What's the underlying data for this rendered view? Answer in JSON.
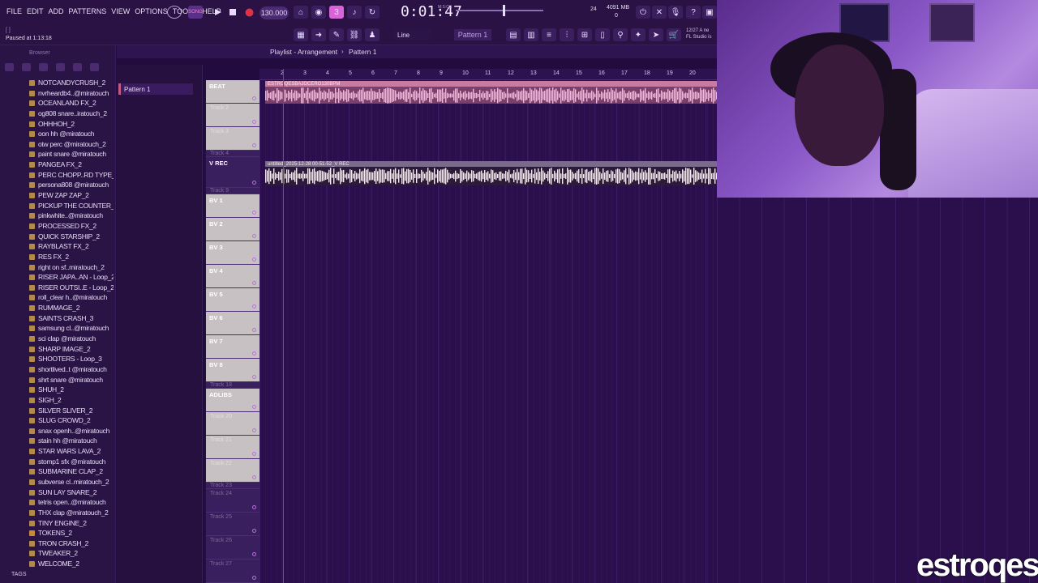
{
  "menu": [
    "FILE",
    "EDIT",
    "ADD",
    "PATTERNS",
    "VIEW",
    "OPTIONS",
    "TOOLS",
    "HELP"
  ],
  "status": {
    "line1": "[ ]",
    "line2": "Paused at 1:13:18"
  },
  "transport": {
    "tempo": "130.000",
    "time": "0:01:47",
    "time_label": "M:S:CS",
    "cpu": "24",
    "memory": "4091 MB",
    "memory_sub": "0",
    "snap": "Line",
    "pattern": "Pattern 1"
  },
  "news": {
    "line1": "12/27  A ne",
    "line2": "FL Studio is"
  },
  "browser": {
    "title": "Browser",
    "files": [
      "NOTCANDYCRUSH_2",
      "nvrheardb4..@miratouch",
      "OCEANLAND FX_2",
      "og808 snare..iratouch_2",
      "OHHHOH_2",
      "oon hh @miratouch",
      "otw perc @miratouch_2",
      "paint snare @miratouch",
      "PANGEA FX_2",
      "PERC CHOPP..RD TYPE_2",
      "persona808 @miratouch",
      "PEW ZAP ZAP_2",
      "PICKUP THE COUNTER_2",
      "pinkwhite..@miratouch",
      "PROCESSED FX_2",
      "QUICK STARSHIP_2",
      "RAYBLAST FX_2",
      "RES FX_2",
      "right on sf..miratouch_2",
      "RISER JAPA..AN - Loop_2",
      "RISER OUTSI..E - Loop_2",
      "roll_clear h..@miratouch",
      "RUMMAGE_2",
      "SAINTS CRASH_3",
      "samsung cl..@miratouch",
      "sci clap @miratouch",
      "SHARP IMAGE_2",
      "SHOOTERS - Loop_3",
      "shortlived..t @miratouch",
      "shrt snare @miratouch",
      "SHUH_2",
      "SIGH_2",
      "SILVER SLIVER_2",
      "SLUG CROWD_2",
      "snax openh..@miratouch",
      "stain hh @miratouch",
      "STAR WARS LAVA_2",
      "stomp1 sfx @miratouch",
      "SUBMARINE CLAP_2",
      "subverse cl..miratouch_2",
      "SUN LAY SNARE_2",
      "tetris open..@miratouch",
      "THX clap @miratouch_2",
      "TINY ENGINE_2",
      "TOKENS_2",
      "TRON CRASH_2",
      "TWEAKER_2",
      "WELCOME_2"
    ],
    "tags_label": "TAGS"
  },
  "picker": {
    "pattern": "Pattern 1"
  },
  "playlist": {
    "title": "Playlist - Arrangement",
    "crumb": "Pattern 1",
    "ruler": [
      "2",
      "3",
      "4",
      "5",
      "6",
      "7",
      "8",
      "9",
      "10",
      "11",
      "12",
      "13",
      "14",
      "15",
      "16",
      "17",
      "18",
      "19",
      "20"
    ],
    "clip1": "ESTROQESBAJOCERO130BPM",
    "clip2": "untitled_2025-12-28 00-51-52_V REC"
  },
  "tracks": [
    {
      "name": "BEAT",
      "grey": true
    },
    {
      "name": "Track 2",
      "dim": true,
      "grey": true
    },
    {
      "name": "Track 3",
      "dim": true,
      "grey": true
    },
    {
      "name": "Track 4",
      "dim": true
    },
    {
      "name": "V REC"
    },
    {
      "name": "Track 9",
      "dim": true
    },
    {
      "name": "BV 1",
      "grey": true
    },
    {
      "name": "BV 2",
      "grey": true
    },
    {
      "name": "BV 3",
      "grey": true
    },
    {
      "name": "BV 4",
      "grey": true
    },
    {
      "name": "BV 5",
      "grey": true
    },
    {
      "name": "BV 6",
      "grey": true
    },
    {
      "name": "BV 7",
      "grey": true
    },
    {
      "name": "BV 8",
      "grey": true
    },
    {
      "name": "Track 18",
      "dim": true
    },
    {
      "name": "ADLIBS",
      "grey": true
    },
    {
      "name": "Track 20",
      "dim": true,
      "grey": true
    },
    {
      "name": "Track 21",
      "dim": true,
      "grey": true
    },
    {
      "name": "Track 22",
      "dim": true,
      "grey": true
    },
    {
      "name": "Track 23",
      "dim": true
    },
    {
      "name": "Track 24",
      "dim": true
    },
    {
      "name": "Track 25",
      "dim": true
    },
    {
      "name": "Track 26",
      "dim": true
    },
    {
      "name": "Track 27",
      "dim": true
    }
  ],
  "brand": "estroqes",
  "colors": {
    "bg": "#220b3f",
    "accent": "#c87ba1",
    "record": "#e0304a"
  }
}
